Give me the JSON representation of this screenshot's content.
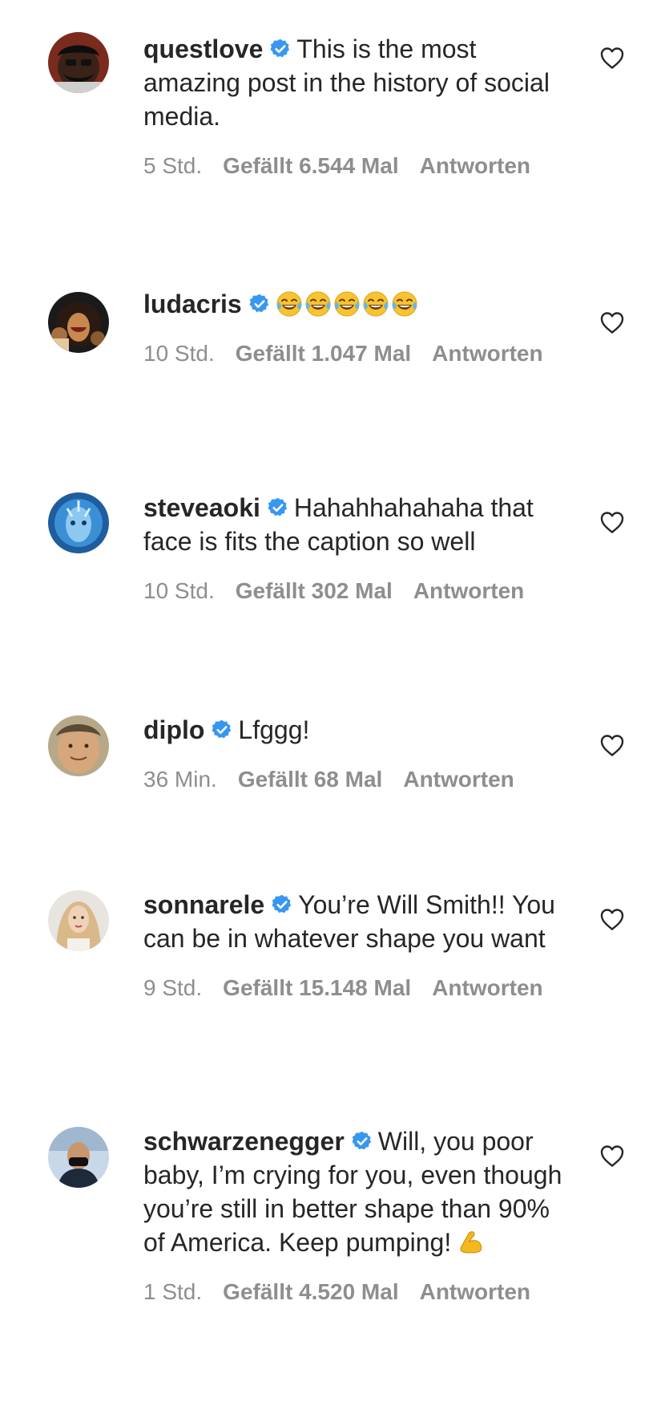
{
  "colors": {
    "verified": "#3897f0",
    "text": "#262626",
    "meta": "#8e8e8e"
  },
  "icons": {
    "verified": "verified-badge-icon",
    "like": "heart-icon",
    "laugh": "face-with-tears-of-joy-emoji",
    "flex": "flexed-biceps-emoji"
  },
  "comments": [
    {
      "username": "questlove",
      "text": "This is the most amazing post in the history of social media.",
      "time": "5 Std.",
      "likes": "Gefällt 6.544 Mal",
      "reply": "Antworten"
    },
    {
      "username": "ludacris",
      "text": "",
      "emoji_text": "😂😂😂😂😂",
      "time": "10 Std.",
      "likes": "Gefällt 1.047 Mal",
      "reply": "Antworten"
    },
    {
      "username": "steveaoki",
      "text": "Hahahhahahaha that face is fits the caption so well",
      "time": "10 Std.",
      "likes": "Gefällt 302 Mal",
      "reply": "Antworten"
    },
    {
      "username": "diplo",
      "text": "Lfggg!",
      "time": "36 Min.",
      "likes": "Gefällt 68 Mal",
      "reply": "Antworten"
    },
    {
      "username": "sonnarele",
      "text": "You’re Will Smith!! You can be in whatever shape you want",
      "time": "9 Std.",
      "likes": "Gefällt 15.148 Mal",
      "reply": "Antworten"
    },
    {
      "username": "schwarzenegger",
      "text": "Will, you poor baby, I’m crying for you, even though you’re still in better shape than 90% of America. Keep pumping!",
      "emoji_text": "💪",
      "time": "1 Std.",
      "likes": "Gefällt 4.520 Mal",
      "reply": "Antworten"
    }
  ]
}
